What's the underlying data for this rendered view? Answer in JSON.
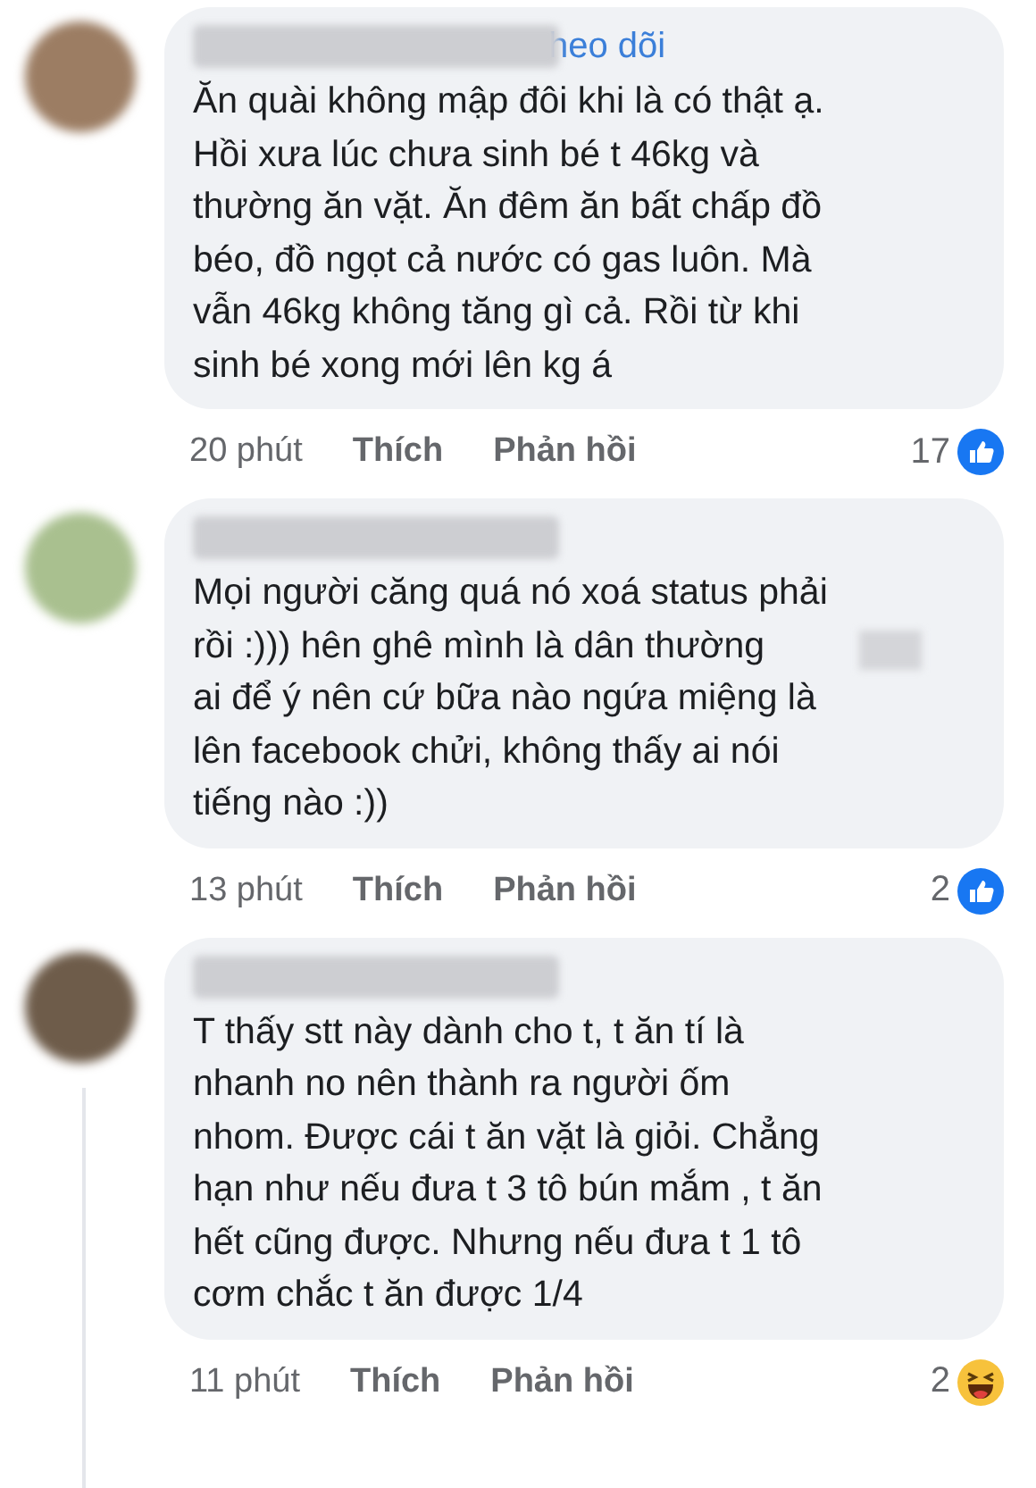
{
  "comments": [
    {
      "color": "#9c7d63",
      "follow": "heo dõi",
      "text": "Ăn quài không mập đôi khi là có thật ạ.\nHồi xưa lúc chưa sinh bé t 46kg và\nthường ăn vặt. Ăn đêm ăn bất chấp đồ\nbéo, đồ ngọt cả nước có gas luôn. Mà\nvẫn 46kg không tăng gì cả. Rồi từ khi\nsinh bé xong mới lên kg á",
      "redacted_in_text": false,
      "time": "20 phút",
      "like": "Thích",
      "reply": "Phản hồi",
      "reaction": {
        "kind": "like",
        "count": "17"
      },
      "thread_line": false
    },
    {
      "color": "#a9c08f",
      "text": "Mọi người căng quá nó xoá status phải\nrồi :))) hên ghê mình là dân thường\nai để ý nên cứ bữa nào ngứa miệng là\nlên facebook chửi, không thấy ai nói\ntiếng nào :))",
      "redacted_in_text": true,
      "time": "13 phút",
      "like": "Thích",
      "reply": "Phản hồi",
      "reaction": {
        "kind": "like",
        "count": "2"
      },
      "thread_line": false
    },
    {
      "color": "#6e5c4a",
      "text": "T thấy stt này dành cho t, t ăn tí là\nnhanh no nên thành ra người ốm\nnhom. Được cái t ăn vặt là giỏi. Chẳng\nhạn như nếu đưa t 3 tô bún mắm , t ăn\nhết cũng được. Nhưng nếu đưa t 1 tô\ncơm chắc t ăn được 1/4",
      "redacted_in_text": false,
      "time": "11 phút",
      "like": "Thích",
      "reply": "Phản hồi",
      "reaction": {
        "kind": "haha",
        "count": "2"
      },
      "thread_line": true
    }
  ]
}
